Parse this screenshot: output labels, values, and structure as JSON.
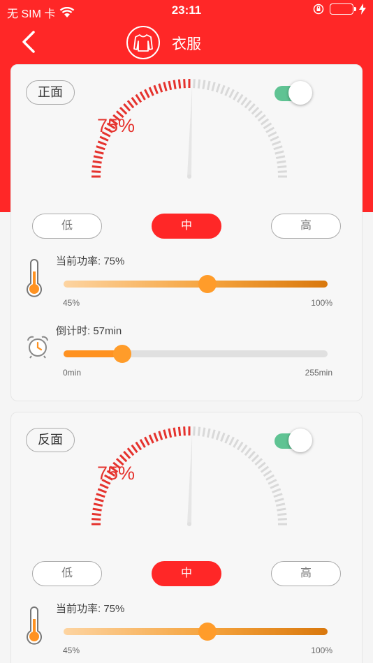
{
  "status": {
    "carrier": "无 SIM 卡",
    "time": "23:11"
  },
  "nav": {
    "title": "衣服"
  },
  "cards": [
    {
      "side": "正面",
      "enabled": true,
      "gauge_percent": 75,
      "gauge_text": "75%",
      "levels": [
        "低",
        "中",
        "高"
      ],
      "active_level": "中",
      "power": {
        "label": "当前功率: 75%",
        "value": 75,
        "min": 45,
        "max": 100,
        "min_label": "45%",
        "max_label": "100%"
      },
      "timer": {
        "label": "倒计时: 57min",
        "value": 57,
        "min": 0,
        "max": 255,
        "min_label": "0min",
        "max_label": "255min"
      }
    },
    {
      "side": "反面",
      "enabled": true,
      "gauge_percent": 75,
      "gauge_text": "75%",
      "levels": [
        "低",
        "中",
        "高"
      ],
      "active_level": "中",
      "power": {
        "label": "当前功率: 75%",
        "value": 75,
        "min": 45,
        "max": 100,
        "min_label": "45%",
        "max_label": "100%"
      }
    }
  ],
  "colors": {
    "brand": "#ff2727",
    "gauge_active": "#e5322d",
    "gauge_inactive": "#d9d9d9",
    "toggle_on": "#5fc393",
    "slider": "#ff9221"
  }
}
